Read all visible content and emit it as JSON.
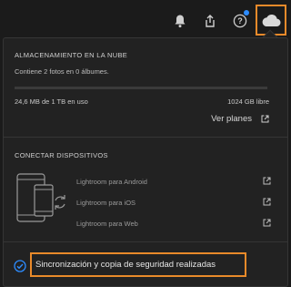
{
  "toolbar": {
    "bell_icon": "bell-icon",
    "share_icon": "share-icon",
    "help_icon": "help-icon",
    "cloud_icon": "cloud-icon"
  },
  "cloud_storage": {
    "title": "ALMACENAMIENTO EN LA NUBE",
    "contents": "Contiene 2 fotos en 0 álbumes.",
    "used_fraction": 0.0,
    "used": "24,6 MB de 1 TB en uso",
    "free": "1024 GB libre",
    "plans_link": "Ver planes"
  },
  "connect_devices": {
    "title": "CONECTAR DISPOSITIVOS",
    "links": [
      {
        "label": "Lightroom para Android"
      },
      {
        "label": "Lightroom para iOS"
      },
      {
        "label": "Lightroom para Web"
      }
    ]
  },
  "sync_status": {
    "text": "Sincronización y copia de seguridad realizadas"
  },
  "colors": {
    "highlight": "#e98a2a",
    "check": "#2d8cff",
    "background": "#1b1b1b"
  }
}
